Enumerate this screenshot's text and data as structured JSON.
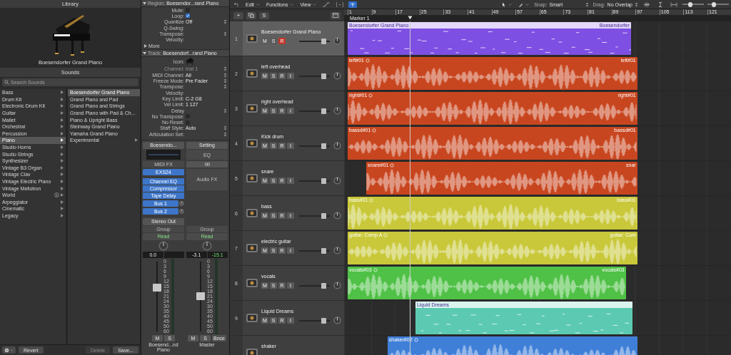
{
  "library": {
    "title": "Library",
    "preview_name": "Boesendorfer Grand Piano",
    "sounds_title": "Sounds",
    "search_placeholder": "Search Sounds",
    "categories": [
      {
        "label": "Bass",
        "selected": false
      },
      {
        "label": "Drum Kit",
        "selected": false
      },
      {
        "label": "Electronic Drum Kit",
        "selected": false
      },
      {
        "label": "Guitar",
        "selected": false
      },
      {
        "label": "Mallet",
        "selected": false
      },
      {
        "label": "Orchestral",
        "selected": false
      },
      {
        "label": "Percussion",
        "selected": false
      },
      {
        "label": "Piano",
        "selected": true
      },
      {
        "label": "Studio Horns",
        "selected": false
      },
      {
        "label": "Studio Strings",
        "selected": false
      },
      {
        "label": "Synthesizer",
        "selected": false
      },
      {
        "label": "Vintage B3 Organ",
        "selected": false
      },
      {
        "label": "Vintage Clav",
        "selected": false
      },
      {
        "label": "Vintage Electric Piano",
        "selected": false
      },
      {
        "label": "Vintage Mellotron",
        "selected": false
      },
      {
        "label": "World",
        "selected": false,
        "download": true
      },
      {
        "label": "Arpeggiator",
        "selected": false
      },
      {
        "label": "Cinematic",
        "selected": false
      },
      {
        "label": "Legacy",
        "selected": false
      }
    ],
    "presets": [
      {
        "label": "Boesendorfer Grand Piano",
        "selected": true,
        "submenu": false
      },
      {
        "label": "Grand Piano and Pad",
        "selected": false,
        "submenu": false
      },
      {
        "label": "Grand Piano and Strings",
        "selected": false,
        "submenu": false
      },
      {
        "label": "Grand Piano with Pad & Ch...",
        "selected": false,
        "submenu": false
      },
      {
        "label": "Piano & Upright Bass",
        "selected": false,
        "submenu": false
      },
      {
        "label": "Steinway Grand Piano",
        "selected": false,
        "submenu": false
      },
      {
        "label": "Yamaha Grand Piano",
        "selected": false,
        "submenu": false
      },
      {
        "label": "Experimental",
        "selected": false,
        "submenu": true
      }
    ],
    "footer_buttons": [
      {
        "label": "Revert",
        "disabled": false
      },
      {
        "label": "Delete",
        "disabled": true
      },
      {
        "label": "Save...",
        "disabled": false
      }
    ]
  },
  "inspector": {
    "region": {
      "title": "Region:",
      "name": "Boesendor...rand Piano",
      "expanded": true,
      "more": "More",
      "rows": [
        {
          "kind": "checkbox",
          "label": "Mute:",
          "checked": false
        },
        {
          "kind": "checkbox",
          "label": "Loop:",
          "checked": true
        },
        {
          "kind": "select",
          "label": "Quantize",
          "value": "Off"
        },
        {
          "kind": "text",
          "label": "Q-Swing:"
        },
        {
          "kind": "select",
          "label": "Transpose:"
        },
        {
          "kind": "text",
          "label": "Velocity:"
        }
      ]
    },
    "track": {
      "title": "Track:",
      "name": "Boesendorf...rand Piano",
      "expanded": true,
      "rows": [
        {
          "kind": "icon",
          "label": "Icon:"
        },
        {
          "kind": "select",
          "label": "Channel:",
          "value": "Inst 1",
          "disabled": true
        },
        {
          "kind": "select",
          "label": "MIDI Channel:",
          "value": "All"
        },
        {
          "kind": "select",
          "label": "Freeze Mode:",
          "value": "Pre Fader"
        },
        {
          "kind": "select",
          "label": "Transpose:"
        },
        {
          "kind": "text",
          "label": "Velocity:"
        },
        {
          "kind": "text",
          "label": "Key Limit:",
          "value": "C-2  G8"
        },
        {
          "kind": "text",
          "label": "Vel Limit:",
          "value": "1  127"
        },
        {
          "kind": "select",
          "label": "Delay"
        },
        {
          "kind": "checkbox",
          "label": "No Transpose:",
          "checked": false
        },
        {
          "kind": "checkbox",
          "label": "No Reset:",
          "checked": false
        },
        {
          "kind": "select",
          "label": "Staff Style:",
          "value": "Auto"
        },
        {
          "kind": "select",
          "label": "Articulation Set:"
        }
      ]
    },
    "strips": [
      {
        "top": [
          {
            "kind": "setting",
            "label": "Boesendo..."
          },
          {
            "kind": "eq_graph"
          },
          {
            "kind": "caption",
            "label": "MIDI FX"
          },
          {
            "kind": "plugin",
            "label": "EXS24"
          },
          {
            "kind": "plugin_group",
            "labels": [
              "Channel EQ",
              "Compressor",
              "Tape Delay"
            ]
          },
          {
            "kind": "send",
            "label": "Bus 1"
          },
          {
            "kind": "send",
            "label": "Bus 2"
          }
        ],
        "output": "Stereo Out",
        "group": "Group",
        "automation": "Read",
        "volume": "0.0",
        "level": 0.62,
        "scale": [
          "0",
          "3",
          "6",
          "9",
          "12",
          "15",
          "18",
          "21",
          "24",
          "30",
          "35",
          "40",
          "45",
          "50",
          "60"
        ],
        "mute": "M",
        "solo": "S",
        "name": "Boesend...nd Piano"
      },
      {
        "top": [
          {
            "kind": "setting",
            "label": "Setting"
          },
          {
            "kind": "area",
            "label": "EQ",
            "tall": false
          },
          {
            "kind": "link"
          },
          {
            "kind": "area",
            "label": "Audio FX",
            "tall": true
          }
        ],
        "group": "Group",
        "automation": "Read",
        "volume": "-3.1",
        "peak": "-15.1",
        "level": 0.5,
        "scale": [
          "0",
          "3",
          "6",
          "9",
          "12",
          "15",
          "18",
          "21",
          "24",
          "30",
          "35",
          "40",
          "45",
          "50",
          "60"
        ],
        "bounce": "Bnce",
        "mute": "M",
        "solo": "S",
        "name": "Master"
      }
    ]
  },
  "arrange": {
    "menus": [
      "Edit",
      "Functions",
      "View"
    ],
    "snap_label": "Snap:",
    "snap": "Smart",
    "drag_label": "Drag:",
    "drag": "No Overlap",
    "zoom_sliders": [
      {
        "level": 0.35
      },
      {
        "level": 0.3
      }
    ],
    "header_tools": {
      "add": "+",
      "solo": "S"
    },
    "ruler": [
      "1",
      "9",
      "17",
      "25",
      "33",
      "41",
      "49",
      "57",
      "65",
      "73",
      "81",
      "89",
      "97",
      "105",
      "113",
      "121"
    ],
    "marker": "Marker 1",
    "tracks": [
      {
        "number": "1",
        "name": "Boesendorfer Grand Piano",
        "selected": true,
        "buttons": [
          {
            "label": "M",
            "on": false
          },
          {
            "label": "S",
            "on": false
          },
          {
            "label": "R",
            "on": true
          }
        ],
        "level": 0.8,
        "region": {
          "kind": "midi",
          "label": "Boesendorfer Grand Piano",
          "label_right": "Boesendorfer",
          "color": "#7e4fe3"
        }
      },
      {
        "number": "2",
        "name": "left overhead",
        "selected": false,
        "buttons": [
          {
            "label": "M",
            "on": false
          },
          {
            "label": "S",
            "on": false
          },
          {
            "label": "R",
            "on": false
          },
          {
            "label": "I",
            "on": false
          }
        ],
        "level": 0.8,
        "region": {
          "kind": "audio",
          "label": "left#01",
          "label_right": "left#01",
          "color": "#c8461f",
          "loop": true
        }
      },
      {
        "number": "3",
        "name": "right overhead",
        "selected": false,
        "buttons": [
          {
            "label": "M",
            "on": false
          },
          {
            "label": "S",
            "on": false
          },
          {
            "label": "R",
            "on": false
          },
          {
            "label": "I",
            "on": false
          }
        ],
        "level": 0.8,
        "region": {
          "kind": "audio",
          "label": "right#01",
          "label_right": "right#01",
          "color": "#c8461f",
          "loop": true
        }
      },
      {
        "number": "4",
        "name": "Kick drum",
        "selected": false,
        "buttons": [
          {
            "label": "M",
            "on": false
          },
          {
            "label": "S",
            "on": false
          },
          {
            "label": "R",
            "on": false
          },
          {
            "label": "I",
            "on": false
          }
        ],
        "level": 0.8,
        "region": {
          "kind": "audio",
          "label": "bassd#01",
          "label_right": "bassd#01",
          "color": "#c8461f",
          "loop": true
        }
      },
      {
        "number": "5",
        "name": "snare",
        "selected": false,
        "buttons": [
          {
            "label": "M",
            "on": false
          },
          {
            "label": "S",
            "on": false
          },
          {
            "label": "R",
            "on": false
          },
          {
            "label": "I",
            "on": false
          }
        ],
        "level": 0.8,
        "region": {
          "kind": "audio",
          "label": "snare#01",
          "label_right": "snar",
          "color": "#c8461f",
          "loop": true
        }
      },
      {
        "number": "6",
        "name": "bass",
        "selected": false,
        "buttons": [
          {
            "label": "M",
            "on": false
          },
          {
            "label": "S",
            "on": false
          },
          {
            "label": "R",
            "on": false
          },
          {
            "label": "I",
            "on": false
          }
        ],
        "level": 0.8,
        "region": {
          "kind": "audio",
          "label": "bass#01",
          "label_right": "bass#01",
          "color": "#c9c83a",
          "loop": true
        }
      },
      {
        "number": "7",
        "name": "electric guitar",
        "selected": false,
        "buttons": [
          {
            "label": "M",
            "on": false
          },
          {
            "label": "S",
            "on": false
          },
          {
            "label": "R",
            "on": false
          },
          {
            "label": "I",
            "on": false
          }
        ],
        "level": 0.8,
        "region": {
          "kind": "audio",
          "label": "guitar: Comp A",
          "label_right": "guitar: Com",
          "color": "#c9c83a",
          "loop": true
        }
      },
      {
        "number": "8",
        "name": "vocals",
        "selected": false,
        "buttons": [
          {
            "label": "M",
            "on": false
          },
          {
            "label": "S",
            "on": false
          },
          {
            "label": "R",
            "on": false
          },
          {
            "label": "I",
            "on": false
          }
        ],
        "level": 0.8,
        "region": {
          "kind": "audio",
          "label": "vocals#03",
          "label_right": "vocals#03",
          "color": "#4fc146",
          "loop": true
        }
      },
      {
        "number": "9",
        "name": "Liquid Dreams",
        "selected": false,
        "buttons": [
          {
            "label": "M",
            "on": false
          },
          {
            "label": "S",
            "on": false
          },
          {
            "label": "R",
            "on": false
          },
          {
            "label": "I",
            "on": false
          }
        ],
        "level": 0.8,
        "region": {
          "kind": "midi",
          "label": "Liquid Dreams",
          "color": "#5ccab2"
        }
      },
      {
        "name": "shaker",
        "selected": false,
        "region": {
          "kind": "audio",
          "label": "shaker#02",
          "color": "#3f7fd8",
          "loop": true
        }
      }
    ]
  }
}
